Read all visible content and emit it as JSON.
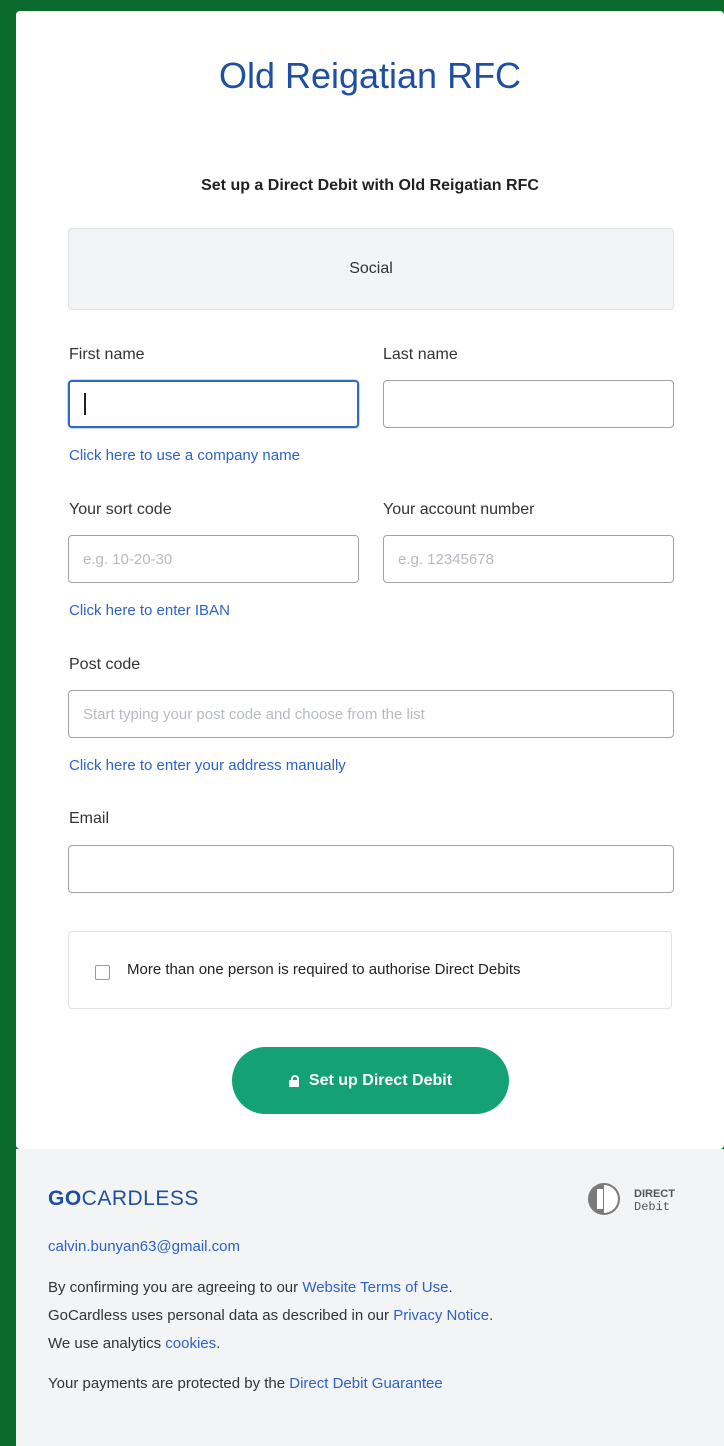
{
  "header": {
    "title": "Old Reigatian RFC",
    "subtitle": "Set up a Direct Debit with Old Reigatian RFC"
  },
  "plan": {
    "name": "Social"
  },
  "form": {
    "first_name_label": "First name",
    "first_name_value": "",
    "last_name_label": "Last name",
    "last_name_value": "",
    "company_link": "Click here to use a company name",
    "sort_code_label": "Your sort code",
    "sort_code_placeholder": "e.g. 10-20-30",
    "account_number_label": "Your account number",
    "account_number_placeholder": "e.g. 12345678",
    "iban_link": "Click here to enter IBAN",
    "postcode_label": "Post code",
    "postcode_placeholder": "Start typing your post code and choose from the list",
    "address_link": "Click here to enter your address manually",
    "email_label": "Email",
    "email_value": "",
    "multi_auth_label": "More than one person is required to authorise Direct Debits",
    "multi_auth_checked": false,
    "submit_label": "Set up Direct Debit"
  },
  "footer": {
    "brand_bold": "GO",
    "brand_rest": "CARDLESS",
    "dd_logo_line1": "DIRECT",
    "dd_logo_line2": "Debit",
    "email": "calvin.bunyan63@gmail.com",
    "terms_text_1": "By confirming you are agreeing to our ",
    "terms_link": "Website Terms of Use",
    "terms_text_2": ". GoCardless uses personal data as described in our ",
    "privacy_link": "Privacy Notice",
    "terms_text_3": ". We use analytics ",
    "cookies_link": "cookies",
    "terms_text_4": ".",
    "guarantee_text": "Your payments are protected by the ",
    "guarantee_link": "Direct Debit Guarantee"
  },
  "colors": {
    "page_background": "#0a6b2c",
    "title_blue": "#1f4fa0",
    "link_blue": "#2c62c9",
    "button_green": "#14a274"
  }
}
